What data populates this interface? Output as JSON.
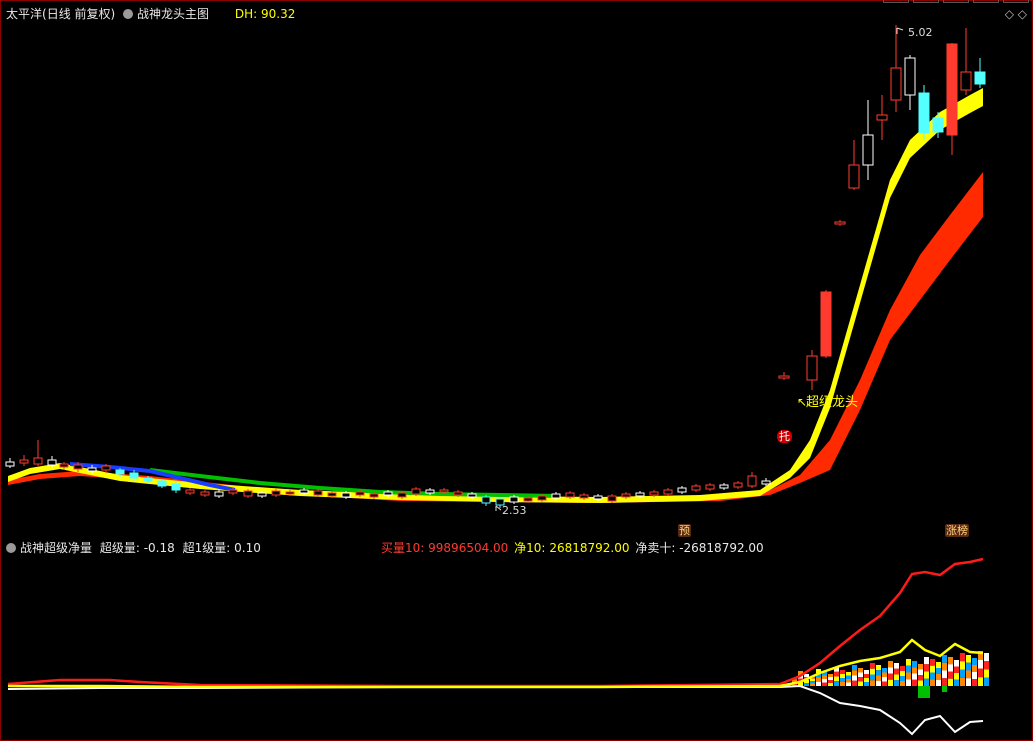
{
  "main_panel": {
    "stock_name": "太平洋",
    "period": "(日线 前复权)",
    "indicator": "战神龙头主图",
    "dh_label": "DH:",
    "dh_value": "90.32",
    "high_label": "5.02",
    "low_label": "2.53",
    "signal_text": "超级龙头",
    "signal_arrow": "↖",
    "tag_tuo": "托",
    "tag_yu": "预",
    "tag_zhang": "涨榜"
  },
  "sub_panel": {
    "indicator": "战神超级净量",
    "super_label": "超级量:",
    "super_value": "-0.18",
    "super1_label": "超1级量:",
    "super1_value": "0.10",
    "buy_label": "买量10:",
    "buy_value": "99896504.00",
    "net_label": "净10:",
    "net_value": "26818792.00",
    "netsell_label": "净卖十:",
    "netsell_value": "-26818792.00"
  },
  "colors": {
    "up": "#ff3b30",
    "down": "#54ffff",
    "yellow": "#ffff00",
    "red_band": "#ff2a00",
    "green_line": "#00c000",
    "blue_line": "#1a3cff",
    "background": "#000000"
  }
}
